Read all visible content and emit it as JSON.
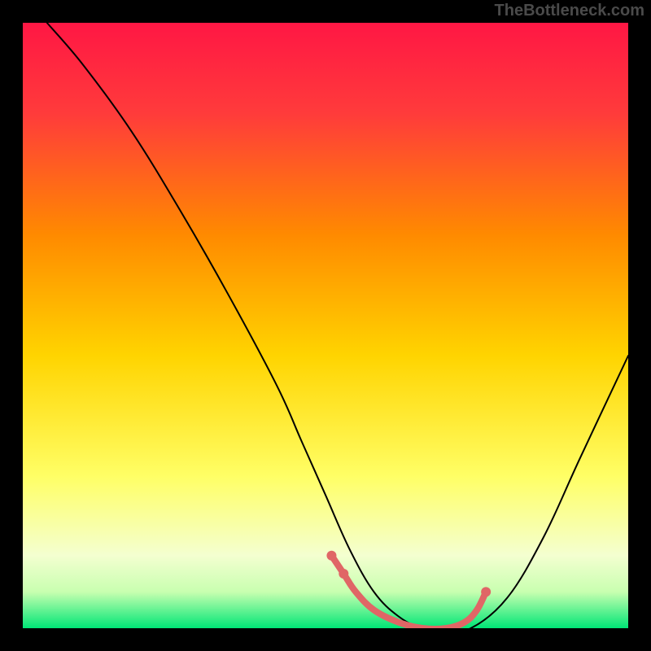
{
  "watermark": "TheBottleneck.com",
  "chart_data": {
    "type": "area",
    "title": "",
    "xlabel": "",
    "ylabel": "",
    "xlim": [
      0,
      100
    ],
    "ylim": [
      0,
      100
    ],
    "background_gradient": {
      "stops": [
        {
          "offset": 0,
          "color": "#ff1744"
        },
        {
          "offset": 15,
          "color": "#ff3b3b"
        },
        {
          "offset": 35,
          "color": "#ff8a00"
        },
        {
          "offset": 55,
          "color": "#ffd400"
        },
        {
          "offset": 75,
          "color": "#ffff66"
        },
        {
          "offset": 88,
          "color": "#f4ffd0"
        },
        {
          "offset": 94,
          "color": "#c8ffb0"
        },
        {
          "offset": 100,
          "color": "#00e676"
        }
      ]
    },
    "series": [
      {
        "name": "bottleneck-curve",
        "type": "line",
        "color": "#000000",
        "x": [
          4,
          10,
          18,
          26,
          34,
          42,
          46,
          50,
          54,
          58,
          62,
          66,
          70,
          74,
          80,
          86,
          92,
          100
        ],
        "values": [
          100,
          93,
          82,
          69,
          55,
          40,
          31,
          22,
          13,
          6,
          2,
          0,
          0,
          0,
          5,
          15,
          28,
          45
        ]
      },
      {
        "name": "optimal-zone-highlight",
        "type": "line",
        "color": "#e06666",
        "width": 8,
        "x": [
          51,
          53,
          55,
          58,
          62,
          66,
          70,
          73,
          75,
          76.5
        ],
        "values": [
          12,
          9,
          6,
          3,
          1,
          0,
          0,
          1,
          3,
          6
        ]
      },
      {
        "name": "optimal-zone-dots",
        "type": "scatter",
        "color": "#e06666",
        "x": [
          51,
          53,
          76.5
        ],
        "values": [
          12,
          9,
          6
        ]
      }
    ]
  }
}
